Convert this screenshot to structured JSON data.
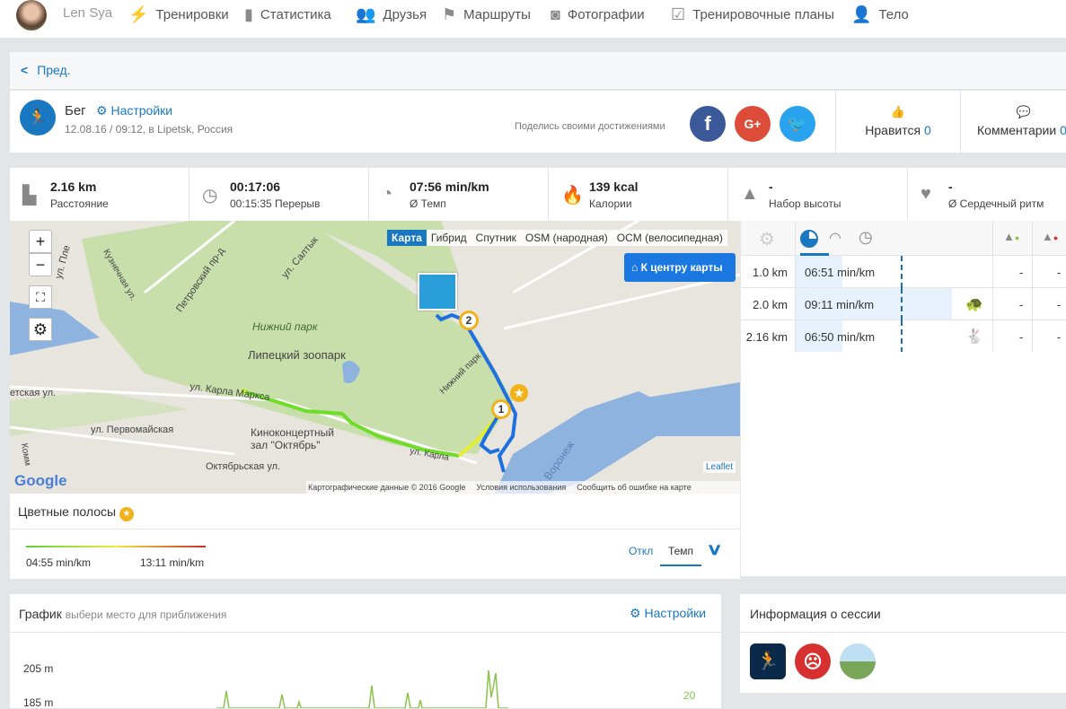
{
  "nav": {
    "user": "Len Sya",
    "items": [
      {
        "label": "Тренировки",
        "icon": "runner-icon"
      },
      {
        "label": "Статистика",
        "icon": "bars-icon"
      },
      {
        "label": "Друзья",
        "icon": "friends-icon"
      },
      {
        "label": "Маршруты",
        "icon": "signpost-icon"
      },
      {
        "label": "Фотографии",
        "icon": "camera-icon"
      },
      {
        "label": "Тренировочные планы",
        "icon": "clipboard-icon"
      },
      {
        "label": "Тело",
        "icon": "person-icon"
      }
    ]
  },
  "back": "Пред.",
  "activity": {
    "sport": "Бег",
    "settings": "Настройки",
    "meta": "12.08.16 / 09:12, в Lipetsk, Россия",
    "share_text": "Поделись своими достижениями",
    "likes_label": "Нравится",
    "likes_count": "0",
    "comments_label": "Комментарии",
    "comments_count": "0"
  },
  "stats": [
    {
      "value": "2.16 km",
      "label": "Расстояние"
    },
    {
      "value": "00:17:06",
      "label": "00:15:35 Перерыв"
    },
    {
      "value": "07:56 min/km",
      "label": "Ø Темп"
    },
    {
      "value": "139 kcal",
      "label": "Калории"
    },
    {
      "value": "-",
      "label": "Набор высоты"
    },
    {
      "value": "-",
      "label": "Ø Сердечный ритм"
    }
  ],
  "map": {
    "tabs": [
      "Карта",
      "Гибрид",
      "Спутник",
      "OSM (народная)",
      "OCM (велосипедная)"
    ],
    "center_btn": "К центру карты",
    "zoom_in": "+",
    "zoom_out": "−",
    "labels": [
      "ул. Пле",
      "Кузнечная ул.",
      "Петровский пр-д",
      "ул. Салтык",
      "Нижний парк",
      "Липецкий зоопарк",
      "етская ул.",
      "ул. Карла Маркса",
      "ул. Первомайская",
      "Киноконцертный",
      "зал \"Октябрь\"",
      "Октябрьская ул.",
      "ул. Карла",
      "Нижний парк",
      "Воронеж",
      "Комм"
    ],
    "markers": [
      "1",
      "2"
    ],
    "leaflet": "Leaflet",
    "logo": "Google",
    "attribution": [
      "Картографические данные © 2016 Google",
      "Условия использования",
      "Сообщить об ошибке на карте"
    ]
  },
  "splits": {
    "rows": [
      {
        "dist": "1.0 km",
        "pace": "06:51 min/km",
        "fill": 0.3,
        "ascent": "-",
        "descent": "-",
        "icon": ""
      },
      {
        "dist": "2.0 km",
        "pace": "09:11 min/km",
        "fill": 1.0,
        "ascent": "-",
        "descent": "-",
        "icon": "turtle-icon"
      },
      {
        "dist": "2.16 km",
        "pace": "06:50 min/km",
        "fill": 0.3,
        "ascent": "-",
        "descent": "-",
        "icon": "rabbit-icon"
      }
    ]
  },
  "colorbar": {
    "title": "Цветные полосы",
    "min": "04:55 min/km",
    "max": "13:11 min/km",
    "off": "Откл",
    "tempo": "Темп"
  },
  "graph": {
    "title": "График",
    "hint": "выбери место для приближения",
    "settings": "Настройки",
    "y_labels": [
      "205 m",
      "185 m"
    ],
    "right_label": "20"
  },
  "session": {
    "title": "Информация о сессии"
  }
}
